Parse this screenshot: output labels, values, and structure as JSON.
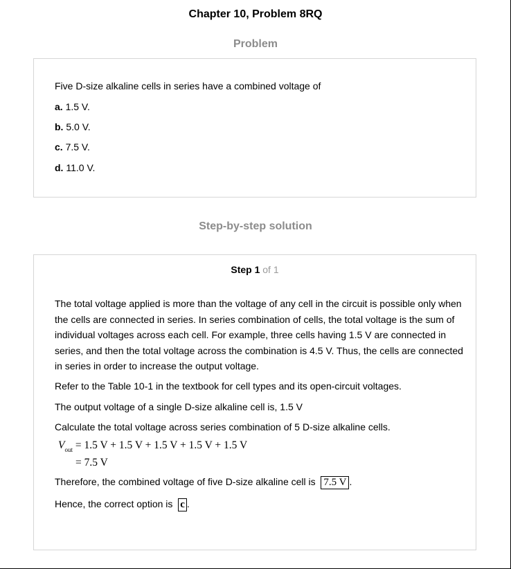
{
  "header": {
    "chapter_title": "Chapter 10, Problem 8RQ",
    "problem_heading": "Problem",
    "solution_heading": "Step-by-step solution"
  },
  "problem": {
    "question": "Five D-size alkaline cells in series have a combined voltage of",
    "options": [
      {
        "letter": "a.",
        "text": "1.5 V."
      },
      {
        "letter": "b.",
        "text": "5.0 V."
      },
      {
        "letter": "c.",
        "text": "7.5 V."
      },
      {
        "letter": "d.",
        "text": "11.0 V."
      }
    ]
  },
  "solution": {
    "step_word": "Step 1",
    "step_of": "of 1",
    "paragraphs": [
      "The total voltage applied is more than the voltage of any cell in the circuit is possible only when the cells are connected in series. In series combination of cells, the total voltage is the sum of individual voltages across each cell. For example, three cells having 1.5 V are connected in series, and then the total voltage across the combination is 4.5 V. Thus, the cells are connected in series in order to increase the output voltage.",
      "Refer to the Table 10-1 in the textbook for cell types and its open-circuit voltages.",
      "The output voltage of a single D-size alkaline cell is, 1.5 V",
      "Calculate the total voltage across series combination of 5 D-size alkaline cells."
    ],
    "equation": {
      "var": "V",
      "sub": "out",
      "line1": "= 1.5 V + 1.5 V + 1.5 V + 1.5 V + 1.5 V",
      "line2": "= 7.5 V"
    },
    "conclusion_text": "Therefore, the combined voltage of five D-size alkaline cell is",
    "conclusion_value": "7.5 V",
    "answer_text": "Hence, the correct option is",
    "answer_value": "c",
    "period": "."
  }
}
